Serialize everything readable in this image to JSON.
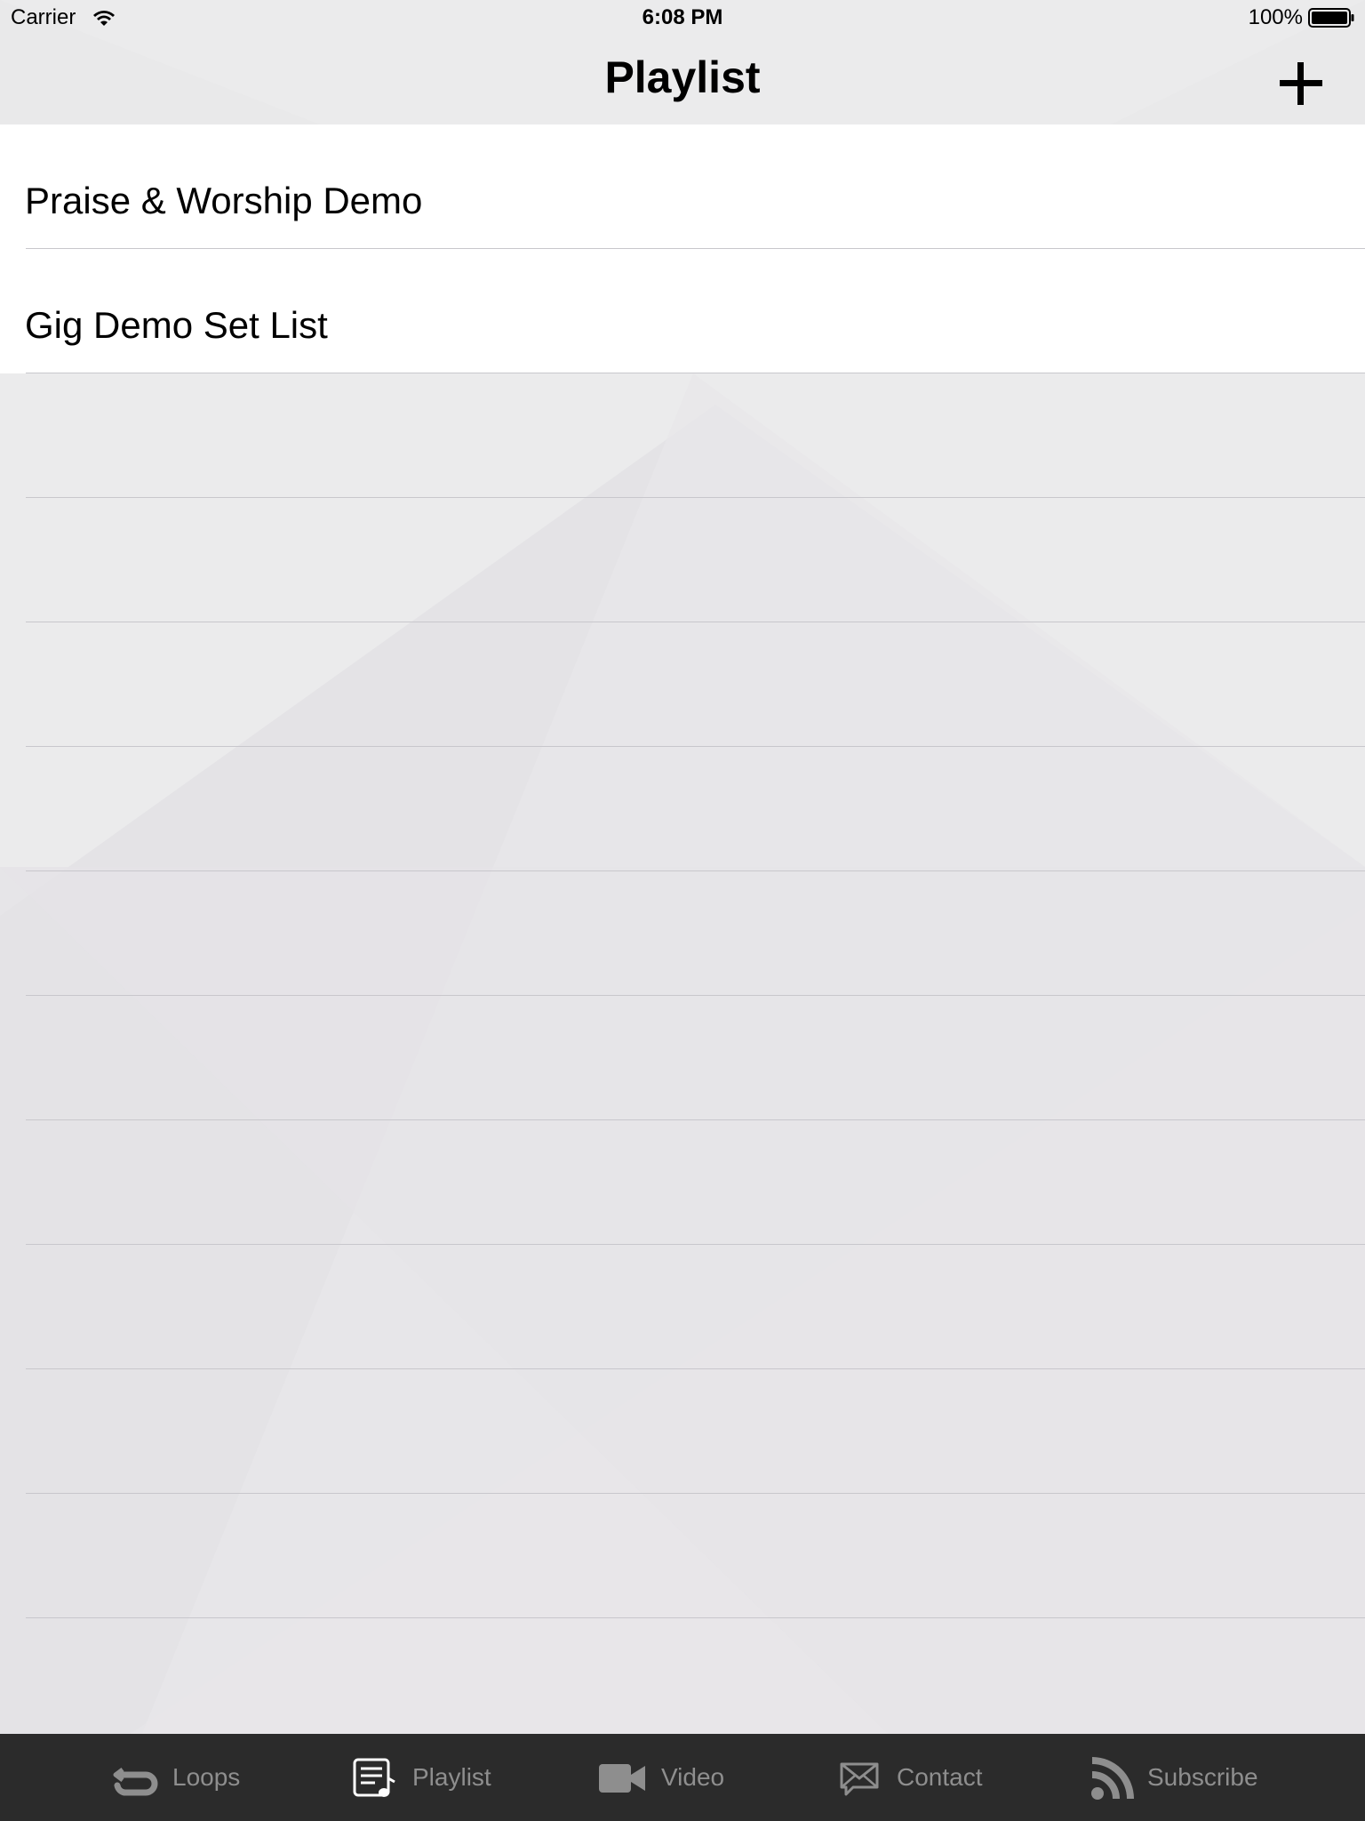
{
  "status_bar": {
    "carrier": "Carrier",
    "time": "6:08 PM",
    "battery": "100%"
  },
  "nav": {
    "title": "Playlist",
    "add_icon": "plus-icon"
  },
  "playlists": [
    "Praise & Worship Demo",
    "Gig Demo Set List"
  ],
  "tabs": [
    {
      "label": "Loops",
      "icon": "loop-icon",
      "active": false
    },
    {
      "label": "Playlist",
      "icon": "playlist-icon",
      "active": true
    },
    {
      "label": "Video",
      "icon": "video-camera-icon",
      "active": false
    },
    {
      "label": "Contact",
      "icon": "envelope-icon",
      "active": false
    },
    {
      "label": "Subscribe",
      "icon": "rss-icon",
      "active": false
    }
  ],
  "colors": {
    "tab_bar_background": "#2b2b2b",
    "tab_inactive": "#8e8e8e",
    "tab_active": "#ffffff",
    "row_background": "#ffffff",
    "separator": "#c8c7cc"
  }
}
